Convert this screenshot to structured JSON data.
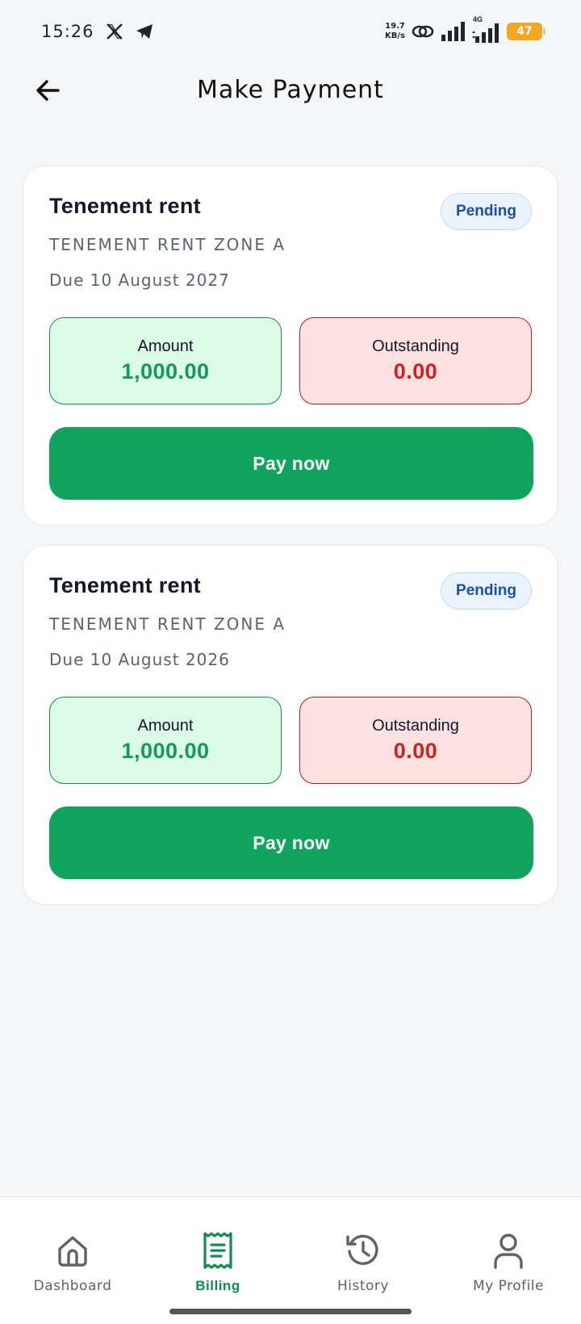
{
  "status_bar": {
    "time": "15:26",
    "speed_value": "19.7",
    "speed_unit": "KB/s",
    "network_type": "4G",
    "battery_level": "47",
    "icons": [
      "x-logo-icon",
      "telegram-icon",
      "link-icon",
      "signal-icon",
      "signal-4g-icon"
    ]
  },
  "header": {
    "title": "Make Payment",
    "back_icon": "arrow-left-icon"
  },
  "bills": [
    {
      "title": "Tenement rent",
      "zone": "TENEMENT RENT ZONE A",
      "due": "Due 10 August 2027",
      "status": "Pending",
      "amount_label": "Amount",
      "amount_value": "1,000.00",
      "outstanding_label": "Outstanding",
      "outstanding_value": "0.00",
      "pay_label": "Pay now"
    },
    {
      "title": "Tenement rent",
      "zone": "TENEMENT RENT ZONE A",
      "due": "Due 10 August 2026",
      "status": "Pending",
      "amount_label": "Amount",
      "amount_value": "1,000.00",
      "outstanding_label": "Outstanding",
      "outstanding_value": "0.00",
      "pay_label": "Pay now"
    }
  ],
  "bottom_nav": {
    "active": "Billing",
    "items": [
      {
        "label": "Dashboard",
        "icon": "home-icon"
      },
      {
        "label": "Billing",
        "icon": "receipt-icon"
      },
      {
        "label": "History",
        "icon": "history-icon"
      },
      {
        "label": "My Profile",
        "icon": "user-icon"
      }
    ]
  },
  "colors": {
    "accent_green": "#10a35c",
    "amount_green": "#149a58",
    "outstanding_red": "#d21f1f",
    "pending_blue": "#1e4fa8",
    "background": "#f5f6f8"
  }
}
